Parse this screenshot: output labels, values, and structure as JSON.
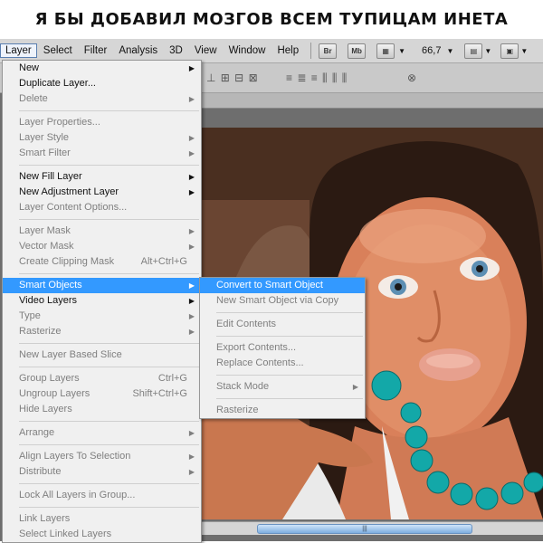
{
  "caption": "Я БЫ ДОБАВИЛ МОЗГОВ ВСЕМ ТУПИЦАМ ИНЕТА",
  "menubar": {
    "items": [
      "Layer",
      "Select",
      "Filter",
      "Analysis",
      "3D",
      "View",
      "Window",
      "Help"
    ],
    "bridge_label": "Br",
    "minibridge_label": "Mb",
    "zoom": "66,7"
  },
  "layer_menu": [
    {
      "label": "New",
      "enabled": true,
      "submenu": true
    },
    {
      "label": "Duplicate Layer...",
      "enabled": true
    },
    {
      "label": "Delete",
      "enabled": false,
      "submenu": true
    },
    {
      "divider": true
    },
    {
      "label": "Layer Properties...",
      "enabled": false
    },
    {
      "label": "Layer Style",
      "enabled": false,
      "submenu": true
    },
    {
      "label": "Smart Filter",
      "enabled": false,
      "submenu": true
    },
    {
      "divider": true
    },
    {
      "label": "New Fill Layer",
      "enabled": true,
      "submenu": true
    },
    {
      "label": "New Adjustment Layer",
      "enabled": true,
      "submenu": true
    },
    {
      "label": "Layer Content Options...",
      "enabled": false
    },
    {
      "divider": true
    },
    {
      "label": "Layer Mask",
      "enabled": false,
      "submenu": true
    },
    {
      "label": "Vector Mask",
      "enabled": false,
      "submenu": true
    },
    {
      "label": "Create Clipping Mask",
      "enabled": false,
      "shortcut": "Alt+Ctrl+G"
    },
    {
      "divider": true
    },
    {
      "label": "Smart Objects",
      "enabled": true,
      "submenu": true,
      "highlighted": true
    },
    {
      "label": "Video Layers",
      "enabled": true,
      "submenu": true
    },
    {
      "label": "Type",
      "enabled": false,
      "submenu": true
    },
    {
      "label": "Rasterize",
      "enabled": false,
      "submenu": true
    },
    {
      "divider": true
    },
    {
      "label": "New Layer Based Slice",
      "enabled": false
    },
    {
      "divider": true
    },
    {
      "label": "Group Layers",
      "enabled": false,
      "shortcut": "Ctrl+G"
    },
    {
      "label": "Ungroup Layers",
      "enabled": false,
      "shortcut": "Shift+Ctrl+G"
    },
    {
      "label": "Hide Layers",
      "enabled": false
    },
    {
      "divider": true
    },
    {
      "label": "Arrange",
      "enabled": false,
      "submenu": true
    },
    {
      "divider": true
    },
    {
      "label": "Align Layers To Selection",
      "enabled": false,
      "submenu": true
    },
    {
      "label": "Distribute",
      "enabled": false,
      "submenu": true
    },
    {
      "divider": true
    },
    {
      "label": "Lock All Layers in Group...",
      "enabled": false
    },
    {
      "divider": true
    },
    {
      "label": "Link Layers",
      "enabled": false
    },
    {
      "label": "Select Linked Layers",
      "enabled": false
    }
  ],
  "smart_objects_menu": [
    {
      "label": "Convert to Smart Object",
      "enabled": true,
      "highlighted": true
    },
    {
      "label": "New Smart Object via Copy",
      "enabled": false
    },
    {
      "divider": true
    },
    {
      "label": "Edit Contents",
      "enabled": false
    },
    {
      "divider": true
    },
    {
      "label": "Export Contents...",
      "enabled": false
    },
    {
      "label": "Replace Contents...",
      "enabled": false
    },
    {
      "divider": true
    },
    {
      "label": "Stack Mode",
      "enabled": false,
      "submenu": true
    },
    {
      "divider": true
    },
    {
      "label": "Rasterize",
      "enabled": false
    }
  ],
  "colors": {
    "highlight": "#3399ff",
    "menu_bg": "#f0f0f0",
    "disabled_text": "#7f7f7f"
  }
}
